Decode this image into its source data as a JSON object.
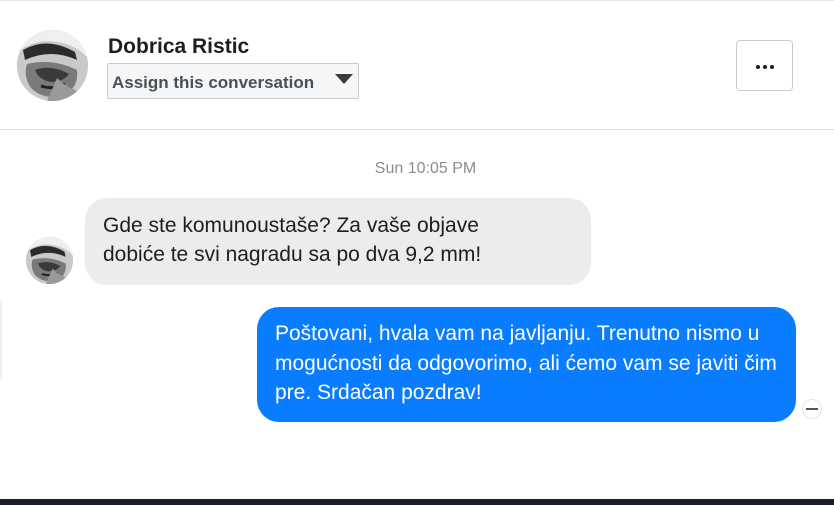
{
  "header": {
    "contact_name": "Dobrica Ristic",
    "assign_select": {
      "selected": "Assign this conversation"
    },
    "more_button_icon": "more-horizontal-icon"
  },
  "conversation": {
    "timestamp": "Sun 10:05 PM",
    "messages": [
      {
        "direction": "incoming",
        "text": "Gde ste komunoustaše? Za vaše objave\ndobiće  te svi nagradu sa po dva 9,2 mm!"
      },
      {
        "direction": "outgoing",
        "text": "Poštovani, hvala vam na javljanju. Trenutno nismo u mogućnosti da odgovorimo, ali ćemo vam se javiti čim pre. Srdačan pozdrav!"
      }
    ]
  },
  "colors": {
    "outgoing_bubble": "#0a7cff",
    "incoming_bubble": "#ececec",
    "timestamp": "#8a8d91"
  }
}
